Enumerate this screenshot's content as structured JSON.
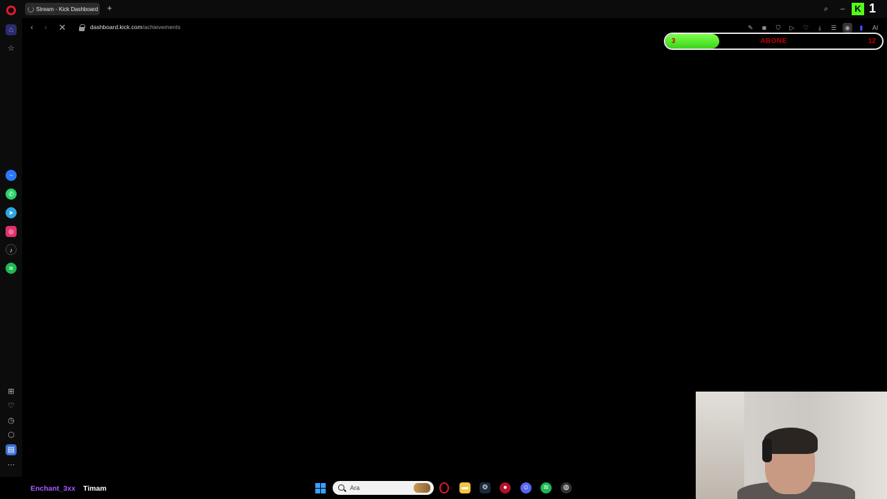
{
  "browser": {
    "tab_title": "Stream - Kick Dashboard",
    "url_host": "dashboard.kick.com",
    "url_path": "/achievements",
    "ai_label": "AI"
  },
  "overlay": {
    "goal_current": "3",
    "goal_label": "ABONE",
    "goal_target": "12",
    "goal_progress": 0.25,
    "kick_logo_text": "K",
    "kick_number": "1"
  },
  "sidebar": {
    "top_icons": [
      "opera-icon",
      "home-icon",
      "star-icon"
    ],
    "apps": [
      "messenger-icon",
      "whatsapp-icon",
      "telegram-icon",
      "instagram-icon",
      "tiktok-icon",
      "spotify-icon"
    ],
    "bottom_icons": [
      "grid-icon",
      "heart-icon",
      "history-icon",
      "cube-icon",
      "notes-icon",
      "more-icon"
    ]
  },
  "chat": {
    "username": "Enchant_3xx",
    "message": "Timam"
  },
  "taskbar": {
    "search_placeholder": "Ara"
  },
  "colors": {
    "accent_green": "#53fc18",
    "opera_red": "#e3192b",
    "chat_username": "#a85cff"
  }
}
